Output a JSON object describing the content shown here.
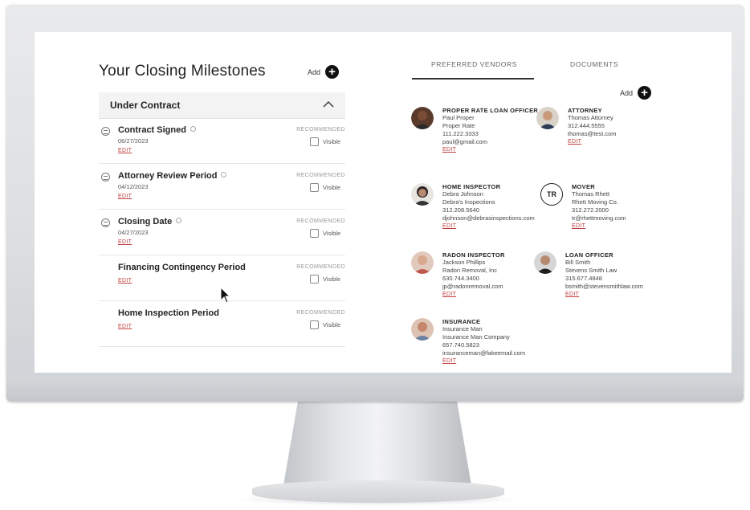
{
  "milestones_panel": {
    "title": "Your Closing Milestones",
    "add_label": "Add",
    "add_button": "+",
    "section": "Under Contract",
    "items": [
      {
        "name": "Contract Signed",
        "date": "06/27/2023",
        "edit": "EDIT",
        "recommended": "RECOMMENDED",
        "visible": "Visible"
      },
      {
        "name": "Attorney Review Period",
        "date": "04/12/2023",
        "edit": "EDIT",
        "recommended": "RECOMMENDED",
        "visible": "Visible"
      },
      {
        "name": "Closing Date",
        "date": "04/27/2023",
        "edit": "EDIT",
        "recommended": "RECOMMENDED",
        "visible": "Visible"
      },
      {
        "name": "Financing Contingency Period",
        "edit": "EDIT",
        "recommended": "RECOMMENDED",
        "visible": "Visible"
      },
      {
        "name": "Home Inspection Period",
        "edit": "EDIT",
        "recommended": "RECOMMENDED",
        "visible": "Visible"
      }
    ]
  },
  "tabs": [
    {
      "label": "PREFERRED VENDORS",
      "active": true
    },
    {
      "label": "DOCUMENTS",
      "active": false
    }
  ],
  "vendors_panel": {
    "add_label": "Add",
    "add_button": "+",
    "vendors": [
      {
        "role": "PROPER RATE LOAN OFFICER",
        "lines": [
          "Paul Proper",
          "Proper Rate",
          "111.222.3333",
          "paul@gmail.com"
        ],
        "edit": "EDIT"
      },
      {
        "role": "ATTORNEY",
        "lines": [
          "Thomas Attorney",
          "312.444.5555",
          "thomas@test.com"
        ],
        "edit": "EDIT"
      },
      {
        "role": "HOME INSPECTOR",
        "lines": [
          "Debra Johnson",
          "Debra's Inspections",
          "312.208.5640",
          "djohnson@debrasinspections.com"
        ],
        "edit": "EDIT"
      },
      {
        "role": "MOVER",
        "initials": "TR",
        "lines": [
          "Thomas Rhett",
          "Rhett Moving Co.",
          "312.272.2000",
          "tr@rhettmoving.com"
        ],
        "edit": "EDIT"
      },
      {
        "role": "RADON INSPECTOR",
        "lines": [
          "Jackson Phillips",
          "Radon Removal, Inc",
          "630.744.3400",
          "jp@radonremoval.com"
        ],
        "edit": "EDIT"
      },
      {
        "role": "LOAN OFFICER",
        "lines": [
          "Bill Smith",
          "Stevens Smith Law",
          "315.677.4848",
          "bsmith@stevensmithlaw.com"
        ],
        "edit": "EDIT"
      },
      {
        "role": "INSURANCE",
        "lines": [
          "Insurance Man",
          "Insurance Man Company",
          "657.740.5823",
          "insuranceman@fakeemail.com"
        ],
        "edit": "EDIT"
      }
    ]
  },
  "colors": {
    "edit_link": "#c23d3d",
    "add_button_bg": "#111111",
    "section_bg": "#f3f3f3"
  }
}
